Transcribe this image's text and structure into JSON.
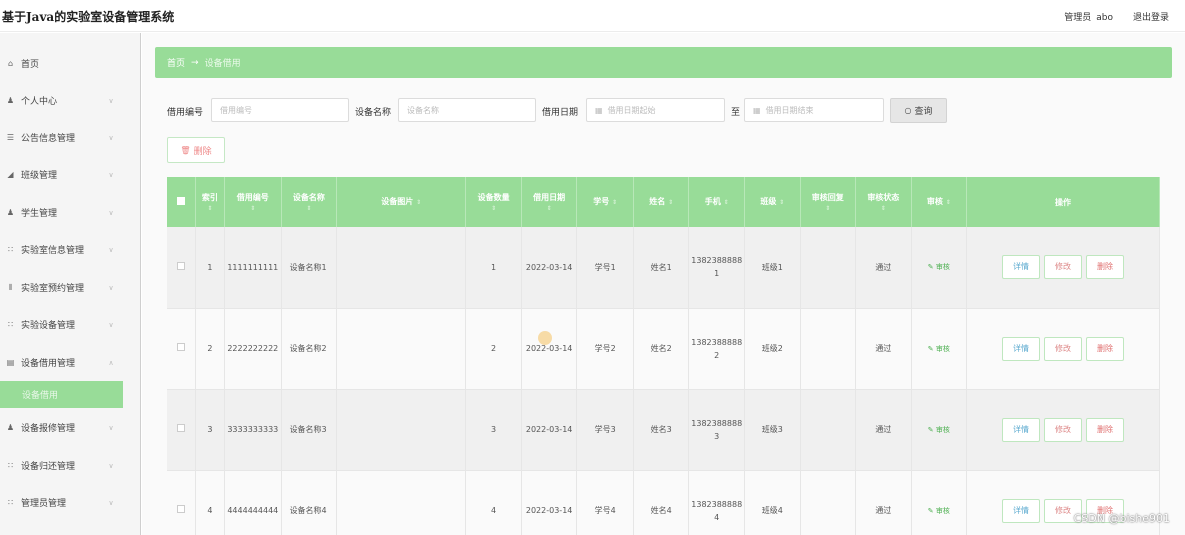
{
  "header": {
    "title": "基于Java的实验室设备管理系统",
    "user_role": "管理员",
    "user_name": "abo",
    "logout": "退出登录"
  },
  "sidebar": {
    "items": [
      {
        "label": "首页",
        "icon": "home-icon"
      },
      {
        "label": "个人中心",
        "icon": "user-icon"
      },
      {
        "label": "公告信息管理",
        "icon": "list-icon"
      },
      {
        "label": "班级管理",
        "icon": "chart-icon"
      },
      {
        "label": "学生管理",
        "icon": "user-icon"
      },
      {
        "label": "实验室信息管理",
        "icon": "grid-icon"
      },
      {
        "label": "实验室预约管理",
        "icon": "bar-chart-icon"
      },
      {
        "label": "实验设备管理",
        "icon": "grid-icon"
      },
      {
        "label": "设备借用管理",
        "icon": "box-icon"
      },
      {
        "label": "设备报修管理",
        "icon": "user-icon"
      },
      {
        "label": "设备归还管理",
        "icon": "grid-icon"
      },
      {
        "label": "管理员管理",
        "icon": "grid-icon"
      }
    ],
    "active_sub": "设备借用"
  },
  "breadcrumb": {
    "home": "首页",
    "separator": "→",
    "current": "设备借用"
  },
  "search": {
    "field1_label": "借用编号",
    "field1_placeholder": "借用编号",
    "field2_label": "设备名称",
    "field2_placeholder": "设备名称",
    "field3_label": "借用日期",
    "date_start_placeholder": "借用日期起始",
    "date_sep": "至",
    "date_end_placeholder": "借用日期结束",
    "query_button": "查询"
  },
  "actions": {
    "delete_batch": "删除"
  },
  "table": {
    "sort_glyph": "⇕",
    "columns": [
      "索引",
      "借用编号",
      "设备名称",
      "设备图片",
      "设备数量",
      "借用日期",
      "学号",
      "姓名",
      "手机",
      "班级",
      "审核回复",
      "审核状态",
      "审核",
      "操作"
    ],
    "rows": [
      {
        "index": "1",
        "borrow_no": "1111111111",
        "device_name": "设备名称1",
        "image": "",
        "quantity": "1",
        "date": "2022-03-14",
        "student_no": "学号1",
        "name": "姓名1",
        "phone": "13823888881",
        "class": "班级1",
        "reply": "",
        "status": "通过",
        "audit": "审核"
      },
      {
        "index": "2",
        "borrow_no": "2222222222",
        "device_name": "设备名称2",
        "image": "",
        "quantity": "2",
        "date": "2022-03-14",
        "student_no": "学号2",
        "name": "姓名2",
        "phone": "13823888882",
        "class": "班级2",
        "reply": "",
        "status": "通过",
        "audit": "审核"
      },
      {
        "index": "3",
        "borrow_no": "3333333333",
        "device_name": "设备名称3",
        "image": "",
        "quantity": "3",
        "date": "2022-03-14",
        "student_no": "学号3",
        "name": "姓名3",
        "phone": "13823888883",
        "class": "班级3",
        "reply": "",
        "status": "通过",
        "audit": "审核"
      },
      {
        "index": "4",
        "borrow_no": "4444444444",
        "device_name": "设备名称4",
        "image": "",
        "quantity": "4",
        "date": "2022-03-14",
        "student_no": "学号4",
        "name": "姓名4",
        "phone": "13823888884",
        "class": "班级4",
        "reply": "",
        "status": "通过",
        "audit": "审核"
      }
    ],
    "row_buttons": {
      "detail": "详情",
      "edit": "修改",
      "delete": "删除"
    }
  },
  "watermark": "CSDN @bishe901",
  "colors": {
    "accent": "#98dc98",
    "sidebar_bg": "#f5f5f5"
  }
}
